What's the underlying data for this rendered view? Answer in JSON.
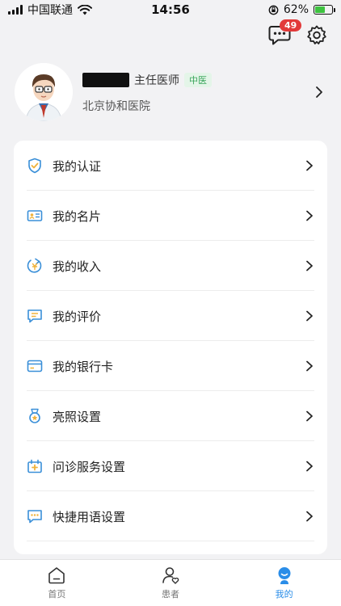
{
  "status_bar": {
    "carrier": "中国联通",
    "time": "14:56",
    "battery_percent": "62%",
    "battery_level": 0.62
  },
  "header": {
    "message_badge": "49"
  },
  "profile": {
    "title": "主任医师",
    "tag": "中医",
    "hospital": "北京协和医院"
  },
  "menu": [
    {
      "label": "我的认证",
      "icon": "shield-check-icon"
    },
    {
      "label": "我的名片",
      "icon": "id-card-icon"
    },
    {
      "label": "我的收入",
      "icon": "income-icon"
    },
    {
      "label": "我的评价",
      "icon": "comment-icon"
    },
    {
      "label": "我的银行卡",
      "icon": "bank-card-icon"
    },
    {
      "label": "亮照设置",
      "icon": "medal-icon"
    },
    {
      "label": "问诊服务设置",
      "icon": "consult-service-icon"
    },
    {
      "label": "快捷用语设置",
      "icon": "quick-reply-icon"
    }
  ],
  "tabs": [
    {
      "label": "首页",
      "icon": "home-icon",
      "active": false
    },
    {
      "label": "患者",
      "icon": "patient-icon",
      "active": false
    },
    {
      "label": "我的",
      "icon": "profile-icon",
      "active": true
    }
  ],
  "colors": {
    "accent": "#2a8de8",
    "menu_icon": "#3a8fd8",
    "badge": "#e23a3a",
    "tag_text": "#3aa55b"
  }
}
